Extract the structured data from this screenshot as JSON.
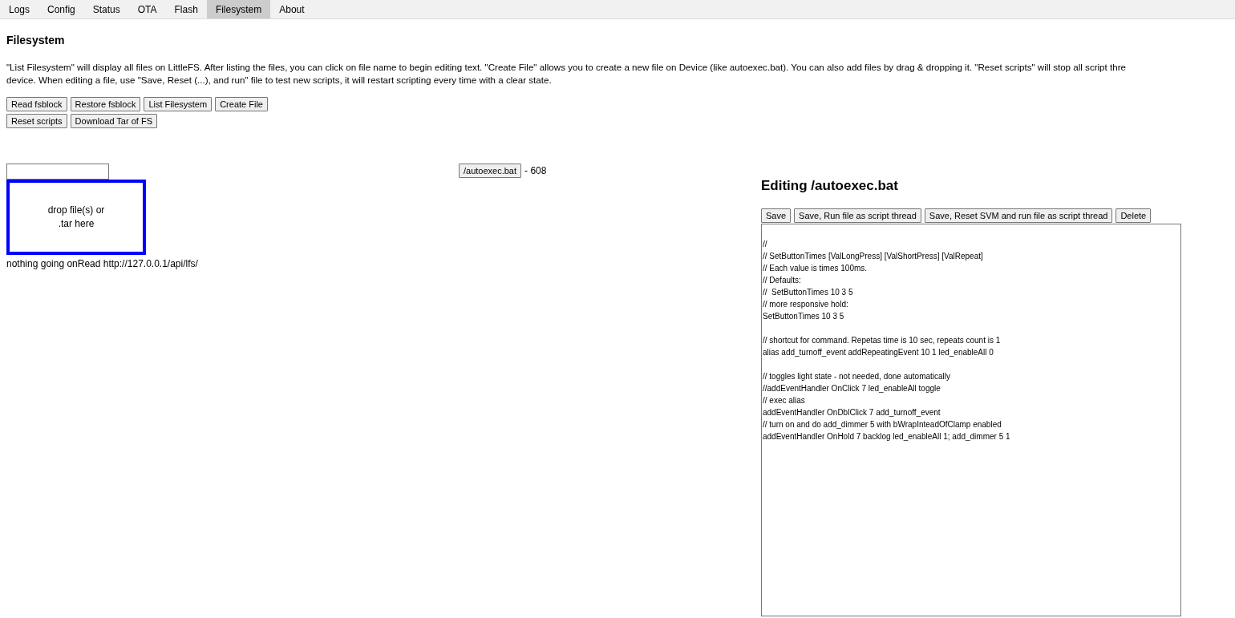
{
  "tabs": [
    {
      "label": "Logs",
      "selected": false
    },
    {
      "label": "Config",
      "selected": false
    },
    {
      "label": "Status",
      "selected": false
    },
    {
      "label": "OTA",
      "selected": false
    },
    {
      "label": "Flash",
      "selected": false
    },
    {
      "label": "Filesystem",
      "selected": true
    },
    {
      "label": "About",
      "selected": false
    }
  ],
  "heading": "Filesystem",
  "description": "\"List Filesystem\" will display all files on LittleFS. After listing the files, you can click on file name to begin editing text. \"Create File\" allows you to create a new file on Device (like autoexec.bat). You can also add files by drag & dropping it. \"Reset scripts\" will stop all script thre\ndevice. When editing a file, use \"Save, Reset (...), and run\" file to test new scripts, it will restart scripting every time with a clear state.",
  "buttons": [
    "Read fsblock",
    "Restore fsblock",
    "List Filesystem",
    "Create File",
    "Reset scripts",
    "Download Tar of FS"
  ],
  "drop_zone": {
    "lines": [
      "drop file(s) or",
      ".tar here"
    ]
  },
  "status": "nothing going onRead http://127.0.0.1/api/lfs/",
  "files": [
    {
      "name": "/autoexec.bat",
      "size": "- 608"
    }
  ],
  "editor": {
    "title": "Editing /autoexec.bat",
    "buttons": [
      "Save",
      "Save, Run file as script thread",
      "Save, Reset SVM and run file as script thread",
      "Delete"
    ],
    "blocks": [
      [
        "//",
        "// SetButtonTimes [ValLongPress] [ValShortPress] [ValRepeat]",
        "// Each value is times 100ms.",
        "// Defaults:",
        "//  SetButtonTimes 10 3 5",
        "// more responsive hold:",
        "SetButtonTimes 10 3 5"
      ],
      [
        "// shortcut for command. Repetas time is 10 sec, repeats count is 1",
        "alias add_turnoff_event addRepeatingEvent 10 1 led_enableAll 0"
      ],
      [
        "// toggles light state - not needed, done automatically",
        "//addEventHandler OnClick 7 led_enableAll toggle",
        "// exec alias",
        "addEventHandler OnDblClick 7 add_turnoff_event",
        "// turn on and do add_dimmer 5 with bWrapInteadOfClamp enabled",
        "addEventHandler OnHold 7 backlog led_enableAll 1; add_dimmer 5 1"
      ]
    ]
  }
}
